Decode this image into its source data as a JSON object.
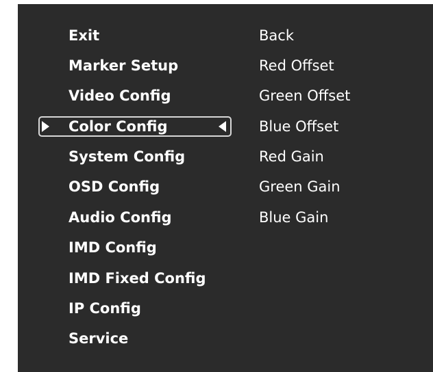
{
  "main_menu": {
    "items": [
      {
        "label": "Exit"
      },
      {
        "label": "Marker Setup"
      },
      {
        "label": "Video Config"
      },
      {
        "label": "Color Config",
        "selected": true
      },
      {
        "label": "System Config"
      },
      {
        "label": "OSD Config"
      },
      {
        "label": "Audio Config"
      },
      {
        "label": "IMD Config"
      },
      {
        "label": "IMD Fixed Config"
      },
      {
        "label": "IP Config"
      },
      {
        "label": "Service"
      }
    ]
  },
  "submenu": {
    "items": [
      {
        "label": "Back"
      },
      {
        "label": "Red Offset"
      },
      {
        "label": "Green Offset"
      },
      {
        "label": "Blue Offset"
      },
      {
        "label": "Red Gain"
      },
      {
        "label": "Green Gain"
      },
      {
        "label": "Blue Gain"
      }
    ]
  },
  "colors": {
    "panel_background": "#2b2b2b",
    "text": "#ffffff",
    "selection_border": "#d8d8d8"
  },
  "icons": {
    "selection_left": "triangle-right-icon",
    "selection_right": "triangle-left-icon"
  }
}
